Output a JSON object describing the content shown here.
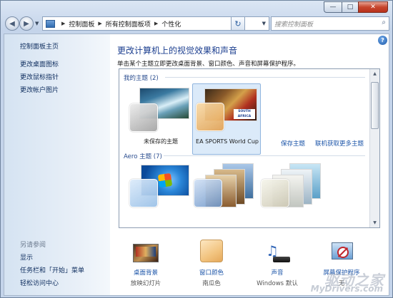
{
  "titlebar": {
    "minimize_glyph": "—",
    "maximize_glyph": "□",
    "close_glyph": "✕"
  },
  "address": {
    "segments": [
      "控制面板",
      "所有控制面板项",
      "个性化"
    ],
    "search_placeholder": "搜索控制面板"
  },
  "sidebar": {
    "home_link": "控制面板主页",
    "links": [
      "更改桌面图标",
      "更改鼠标指针",
      "更改帐户图片"
    ],
    "see_also_heading": "另请参阅",
    "see_also_links": [
      "显示",
      "任务栏和「开始」菜单",
      "轻松访问中心"
    ]
  },
  "main": {
    "title": "更改计算机上的视觉效果和声音",
    "subtitle": "单击某个主题立即更改桌面背景、窗口颜色、声音和屏幕保护程序。",
    "my_themes_label": "我的主题 (2)",
    "my_themes": [
      {
        "name": "未保存的主题",
        "selected": false
      },
      {
        "name": "EA SPORTS World Cup",
        "selected": true
      }
    ],
    "save_theme_link": "保存主题",
    "online_themes_link": "联机获取更多主题",
    "aero_label": "Aero 主题 (7)",
    "south_africa_text": "SOUTH AFRICA"
  },
  "bottom": {
    "items": [
      {
        "label": "桌面背景",
        "value": "放映幻灯片",
        "icon": "desktop-background-icon"
      },
      {
        "label": "窗口颜色",
        "value": "南瓜色",
        "icon": "window-color-icon"
      },
      {
        "label": "声音",
        "value": "Windows 默认",
        "icon": "sound-icon"
      },
      {
        "label": "屏幕保护程序",
        "value": "无",
        "icon": "screensaver-icon"
      }
    ]
  },
  "watermark": {
    "line1": "驱动之家",
    "line2": "MyDrivers.com"
  },
  "colors": {
    "link": "#1b54a8",
    "heading": "#1b3e8f",
    "selected_tile": "#dbeaf9",
    "pumpkin": "#f2c480"
  }
}
